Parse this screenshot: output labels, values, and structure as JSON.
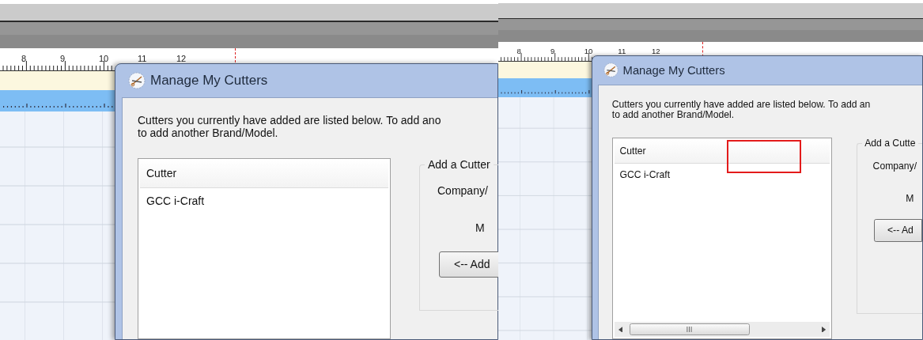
{
  "panels": [
    {
      "title": "Manage My Cutters",
      "ruler": [
        "8",
        "9",
        "10",
        "11",
        "12"
      ],
      "intro": [
        "Cutters you currently have added are listed below. To add ano",
        "to add another Brand/Model."
      ],
      "list": {
        "header": "Cutter",
        "rows": [
          "GCC i-Craft"
        ],
        "scrollbar": false
      },
      "group": {
        "title": "Add a Cutter",
        "labels": [
          "Company/",
          "M"
        ],
        "button": "<-- Add"
      },
      "highlight": false
    },
    {
      "title": "Manage My Cutters",
      "ruler": [
        "8",
        "9",
        "10",
        "11",
        "12"
      ],
      "intro": [
        "Cutters you currently have added are listed below. To add an",
        "to add another Brand/Model."
      ],
      "list": {
        "header": "Cutter",
        "rows": [
          "GCC i-Craft"
        ],
        "scrollbar": true
      },
      "group": {
        "title": "Add a Cutte",
        "labels": [
          "Company/",
          "M"
        ],
        "button": "<-- Ad"
      },
      "highlight": true
    }
  ]
}
